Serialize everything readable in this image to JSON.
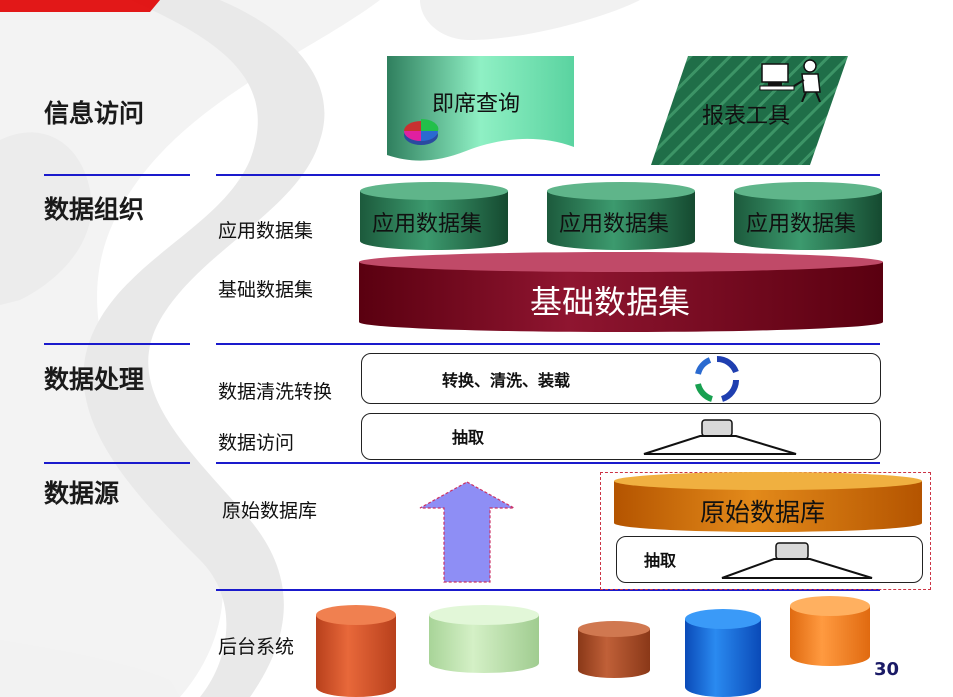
{
  "layers": {
    "access": "信息访问",
    "organization": "数据组织",
    "processing": "数据处理",
    "source": "数据源"
  },
  "rows": {
    "app_dataset": "应用数据集",
    "base_dataset": "基础数据集",
    "clean_convert": "数据清洗转换",
    "data_access": "数据访问",
    "raw_db": "原始数据库",
    "backend": "后台系统"
  },
  "shapes": {
    "adhoc_query": "即席查询",
    "report_tool": "报表工具",
    "app_cylinder": "应用数据集",
    "base_cylinder": "基础数据集",
    "transform_text": "转换、清洗、装载",
    "extract_text": "抽取",
    "raw_cylinder": "原始数据库",
    "raw_extract_text": "抽取"
  },
  "page_number": "30",
  "colors": {
    "line_blue": "#1a1acc",
    "green_dark": "#1e6b45",
    "maroon": "#7a0018",
    "orange": "#d26a00",
    "arrow": "#8e8ef5"
  }
}
